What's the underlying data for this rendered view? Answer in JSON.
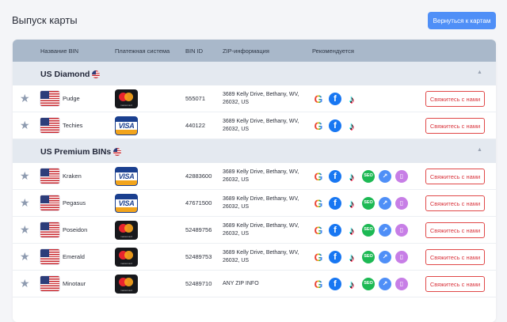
{
  "header": {
    "title": "Выпуск карты",
    "back_label": "Вернуться к картам"
  },
  "table": {
    "columns": [
      "Название BIN",
      "Платежная система",
      "BIN ID",
      "ZIP-информация",
      "Рекомендуется"
    ],
    "contact_label": "Свяжитесь с нами",
    "groups": [
      {
        "title": "US Diamond",
        "rows": [
          {
            "name": "Pudge",
            "payment": "mastercard",
            "bin_id": "555071",
            "zip": "3689 Kelly Drive, Bethany, WV, 26032, US",
            "icons": [
              "google",
              "facebook",
              "tiktok"
            ]
          },
          {
            "name": "Techies",
            "payment": "visa",
            "bin_id": "440122",
            "zip": "3689 Kelly Drive, Bethany, WV, 26032, US",
            "icons": [
              "google",
              "facebook",
              "tiktok"
            ]
          }
        ]
      },
      {
        "title": "US Premium BINs",
        "rows": [
          {
            "name": "Kraken",
            "payment": "visa",
            "bin_id": "42883600",
            "zip": "3689 Kelly Drive, Bethany, WV, 26032, US",
            "icons": [
              "google",
              "facebook",
              "tiktok",
              "seo",
              "ads",
              "app"
            ]
          },
          {
            "name": "Pegasus",
            "payment": "visa",
            "bin_id": "47671500",
            "zip": "3689 Kelly Drive, Bethany, WV, 26032, US",
            "icons": [
              "google",
              "facebook",
              "tiktok",
              "seo",
              "ads",
              "app"
            ]
          },
          {
            "name": "Poseidon",
            "payment": "mastercard",
            "bin_id": "52489756",
            "zip": "3689 Kelly Drive, Bethany, WV, 26032, US",
            "icons": [
              "google",
              "facebook",
              "tiktok",
              "seo",
              "ads",
              "app"
            ]
          },
          {
            "name": "Emerald",
            "payment": "mastercard",
            "bin_id": "52489753",
            "zip": "3689 Kelly Drive, Bethany, WV, 26032, US",
            "icons": [
              "google",
              "facebook",
              "tiktok",
              "seo",
              "ads",
              "app"
            ]
          },
          {
            "name": "Minotaur",
            "payment": "mastercard",
            "bin_id": "52489710",
            "zip": "ANY ZIP INFO",
            "icons": [
              "google",
              "facebook",
              "tiktok",
              "seo",
              "ads",
              "app"
            ]
          }
        ]
      }
    ]
  },
  "payment_labels": {
    "visa": "VISA",
    "mastercard": "mastercard"
  },
  "icon_glyphs": {
    "google": "G",
    "facebook": "f",
    "tiktok": "♪",
    "seo": "SEO",
    "ads": "↗",
    "app": "▯"
  },
  "colors": {
    "accent": "#4f8ff7",
    "contact_red": "#e04848",
    "header_bg": "#a9b8ca",
    "group_bg": "#e4e9f0"
  }
}
